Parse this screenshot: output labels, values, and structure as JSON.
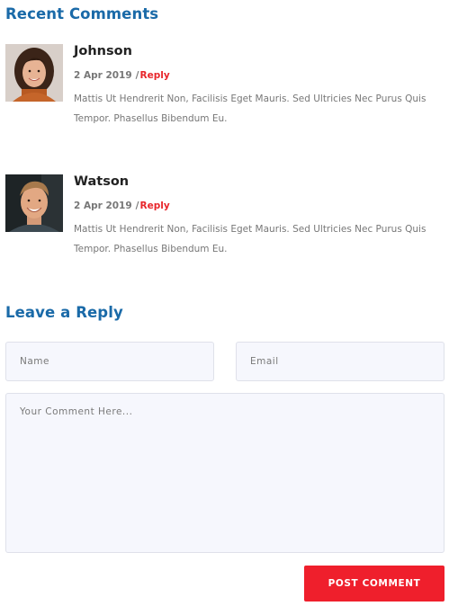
{
  "recent_comments": {
    "title": "Recent Comments",
    "items": [
      {
        "name": "Johnson",
        "date": "2 Apr 2019",
        "separator": "/",
        "reply_label": "Reply",
        "text": "Mattis Ut Hendrerit Non, Facilisis Eget Mauris. Sed Ultricies Nec Purus Quis Tempor. Phasellus Bibendum Eu.",
        "avatar": "woman-avatar"
      },
      {
        "name": "Watson",
        "date": "2 Apr 2019",
        "separator": "/",
        "reply_label": "Reply",
        "text": "Mattis Ut Hendrerit Non, Facilisis Eget Mauris. Sed Ultricies Nec Purus Quis Tempor. Phasellus Bibendum Eu.",
        "avatar": "man-avatar"
      }
    ]
  },
  "leave_reply": {
    "title": "Leave a Reply",
    "name_placeholder": "Name",
    "email_placeholder": "Email",
    "comment_placeholder": "Your Comment Here...",
    "submit_label": "POST COMMENT"
  },
  "colors": {
    "heading": "#1a6aa8",
    "accent": "#ef1f2c",
    "link": "#e8262b",
    "muted_text": "#777777",
    "field_bg": "#f6f7fd",
    "field_border": "#dfe1ea"
  }
}
